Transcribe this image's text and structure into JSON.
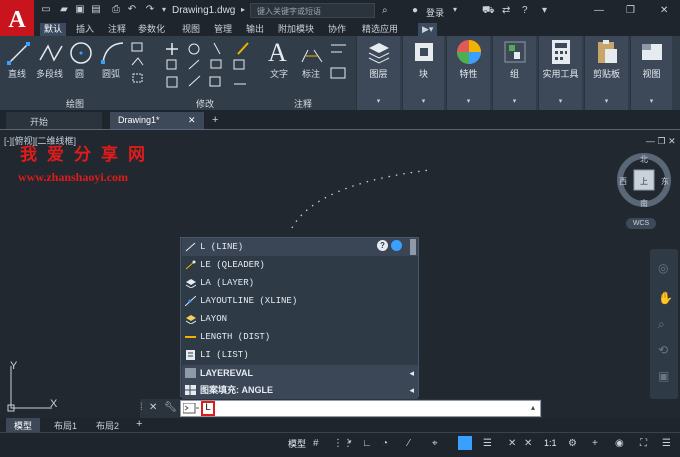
{
  "app": {
    "title": "Drawing1.dwg",
    "logo": "A",
    "search_placeholder": "键入关键字或短语",
    "login": "登录"
  },
  "ribbon_tabs": [
    "默认",
    "插入",
    "注释",
    "参数化",
    "视图",
    "管理",
    "输出",
    "附加模块",
    "协作",
    "精选应用"
  ],
  "ribbon": {
    "draw_tools": [
      "直线",
      "多段线",
      "圆",
      "圆弧"
    ],
    "draw_panel": "绘图",
    "modify_panel": "修改",
    "text_tools": [
      "文字",
      "标注"
    ],
    "annot_panel": "注释",
    "blocks": [
      "图层",
      "块",
      "特性",
      "组",
      "实用工具",
      "剪贴板",
      "视图"
    ]
  },
  "file_tabs": [
    "开始",
    "Drawing1*"
  ],
  "viewport_label": "[-][俯视][二维线框]",
  "watermark": {
    "line1": "我爱分享网",
    "line2": "www.zhanshaoyi.com"
  },
  "viewcube": {
    "north": "北",
    "south": "南",
    "west": "西",
    "east": "东",
    "center": "上",
    "wcs": "WCS"
  },
  "autocomplete": {
    "items": [
      "L (LINE)",
      "LE (QLEADER)",
      "LA (LAYER)",
      "LAYOUTLINE (XLINE)",
      "LAYON",
      "LENGTH (DIST)",
      "LI (LIST)"
    ],
    "sections": [
      "LAYEREVAL",
      "图案填充: ANGLE"
    ]
  },
  "command_input": "L",
  "layout_tabs": [
    "模型",
    "布局1",
    "布局2"
  ],
  "status": {
    "model": "模型",
    "scale": "1:1"
  },
  "axis": {
    "x": "X",
    "y": "Y"
  },
  "colors": {
    "accent": "#c8141c",
    "ribbon_bg": "#323d4a",
    "canvas_bg": "#212830",
    "highlight": "#e01b1b"
  }
}
